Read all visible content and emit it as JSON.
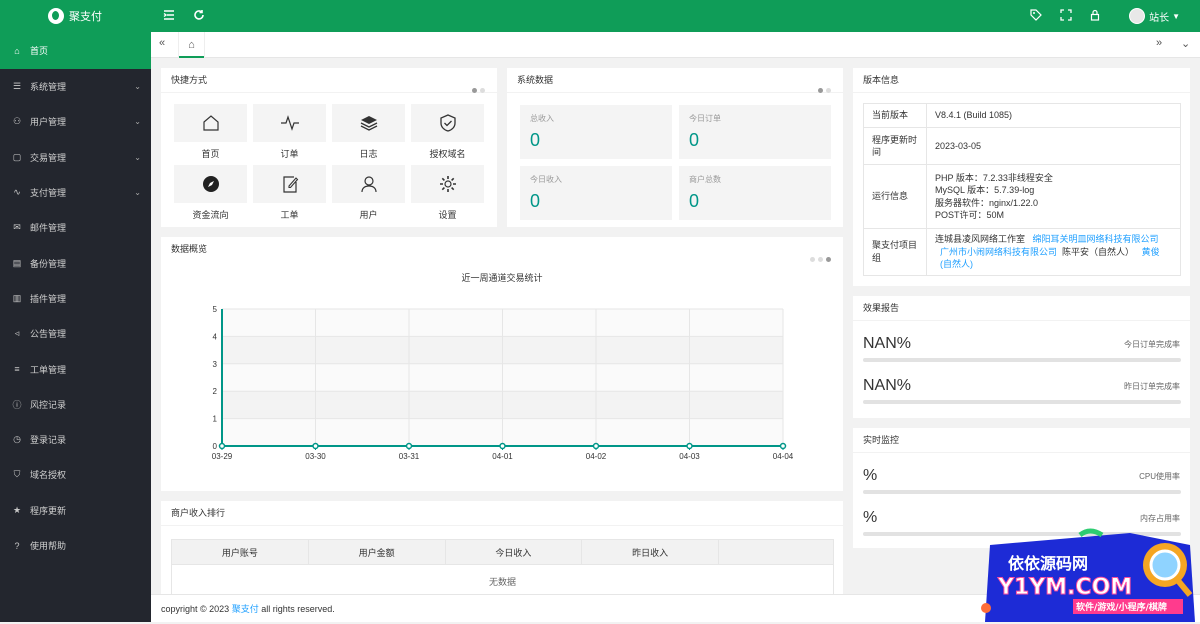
{
  "app": {
    "name": "聚支付"
  },
  "header": {
    "user_name": "站长"
  },
  "sidebar": {
    "items": [
      {
        "label": "首页",
        "icon": "home-icon"
      },
      {
        "label": "系统管理",
        "icon": "sliders-icon"
      },
      {
        "label": "用户管理",
        "icon": "user-icon"
      },
      {
        "label": "交易管理",
        "icon": "file-icon"
      },
      {
        "label": "支付管理",
        "icon": "pulse-icon"
      },
      {
        "label": "邮件管理",
        "icon": "mail-icon"
      },
      {
        "label": "备份管理",
        "icon": "note-icon"
      },
      {
        "label": "插件管理",
        "icon": "chart-icon"
      },
      {
        "label": "公告管理",
        "icon": "speaker-icon"
      },
      {
        "label": "工单管理",
        "icon": "list-icon"
      },
      {
        "label": "风控记录",
        "icon": "info-icon"
      },
      {
        "label": "登录记录",
        "icon": "clock-icon"
      },
      {
        "label": "域名授权",
        "icon": "shield-icon"
      },
      {
        "label": "程序更新",
        "icon": "star-icon"
      },
      {
        "label": "使用帮助",
        "icon": "help-icon"
      }
    ]
  },
  "quick": {
    "title": "快捷方式",
    "items": [
      {
        "label": "首页",
        "icon": "home-icon"
      },
      {
        "label": "订单",
        "icon": "pulse-icon"
      },
      {
        "label": "日志",
        "icon": "layers-icon"
      },
      {
        "label": "授权域名",
        "icon": "shield-check-icon"
      },
      {
        "label": "资金流向",
        "icon": "compass-icon"
      },
      {
        "label": "工单",
        "icon": "edit-icon"
      },
      {
        "label": "用户",
        "icon": "users-icon"
      },
      {
        "label": "设置",
        "icon": "gear-icon"
      }
    ]
  },
  "sysdata": {
    "title": "系统数据",
    "stats": [
      {
        "label": "总收入",
        "value": "0"
      },
      {
        "label": "今日订单",
        "value": "0"
      },
      {
        "label": "今日收入",
        "value": "0"
      },
      {
        "label": "商户总数",
        "value": "0"
      }
    ]
  },
  "version": {
    "title": "版本信息",
    "rows": [
      {
        "key": "当前版本",
        "value": "V8.4.1 (Build 1085)"
      },
      {
        "key": "程序更新时间",
        "value": "2023-03-05"
      },
      {
        "key": "运行信息",
        "lines": [
          "PHP 版本：7.2.33非线程安全",
          "MySQL 版本：5.7.39-log",
          "服务器软件：nginx/1.22.0",
          "POST许可：50M"
        ]
      },
      {
        "key": "聚支付项目组",
        "team": {
          "t1": "连城县凌风网络工作室",
          "l1": "绵阳耳关明皿网络科技有限公司",
          "l2": "广州市小闹网络科技有限公司",
          "t2": "陈平安（自然人）",
          "l3": "黄俊",
          "l4": "(自然人)"
        }
      }
    ]
  },
  "overview": {
    "title": "数据概览"
  },
  "chart_data": {
    "type": "line",
    "title": "近一周通道交易统计",
    "categories": [
      "03-29",
      "03-30",
      "03-31",
      "04-01",
      "04-02",
      "04-03",
      "04-04"
    ],
    "values": [
      0,
      0,
      0,
      0,
      0,
      0,
      0
    ],
    "ylim": [
      0,
      5
    ],
    "yticks": [
      "0",
      "1",
      "2",
      "3",
      "4",
      "5"
    ],
    "color": "#009688",
    "grid": true
  },
  "effect": {
    "title": "效果报告",
    "items": [
      {
        "value": "NAN%",
        "label": "今日订单完成率"
      },
      {
        "value": "NAN%",
        "label": "昨日订单完成率"
      }
    ]
  },
  "monitor": {
    "title": "实时监控",
    "items": [
      {
        "value": "%",
        "label": "CPU使用率"
      },
      {
        "value": "%",
        "label": "内存占用率"
      }
    ]
  },
  "ranking": {
    "title": "商户收入排行",
    "columns": [
      "用户账号",
      "用户金额",
      "今日收入",
      "昨日收入"
    ],
    "empty": "无数据"
  },
  "footer": {
    "prefix": "copyright © 2023",
    "brand": "聚支付",
    "suffix": "all rights reserved."
  },
  "watermark": {
    "line1": "依依源码网",
    "line2": "Y1YM.COM",
    "line3": "软件/游戏/小程序/棋牌"
  },
  "colors": {
    "primary": "#0f9d58",
    "sidebar": "#23262e",
    "accent": "#009688",
    "link": "#1e9fff"
  }
}
